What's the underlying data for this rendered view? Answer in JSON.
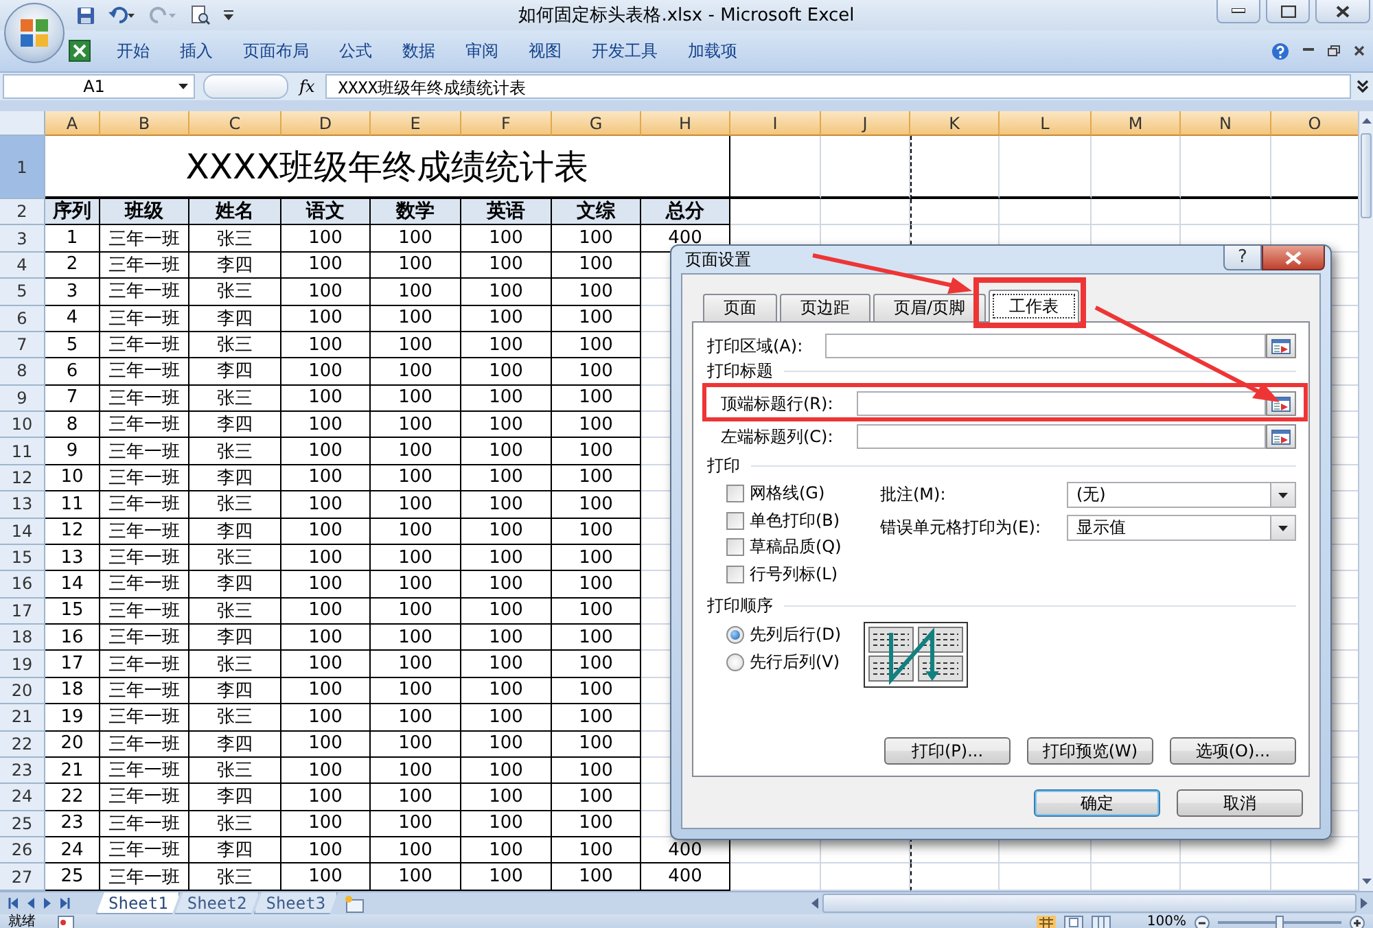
{
  "window": {
    "title": "如何固定标头表格.xlsx - Microsoft Excel"
  },
  "ribbon_tabs": [
    "开始",
    "插入",
    "页面布局",
    "公式",
    "数据",
    "审阅",
    "视图",
    "开发工具",
    "加载项"
  ],
  "formula_bar": {
    "name_box": "A1",
    "function_symbol": "fx",
    "formula": "XXXX班级年终成绩统计表"
  },
  "sheet": {
    "columns": [
      "A",
      "B",
      "C",
      "D",
      "E",
      "F",
      "G",
      "H",
      "I",
      "J",
      "K",
      "L",
      "M",
      "N",
      "O"
    ],
    "title_row": {
      "number": "1",
      "text": "XXXX班级年终成绩统计表"
    },
    "header_row": {
      "number": "2",
      "cells": [
        "序列",
        "班级",
        "姓名",
        "语文",
        "数学",
        "英语",
        "文综",
        "总分"
      ]
    },
    "rows": [
      {
        "number": "3",
        "cells": [
          "1",
          "三年一班",
          "张三",
          "100",
          "100",
          "100",
          "100",
          "400"
        ]
      },
      {
        "number": "4",
        "cells": [
          "2",
          "三年一班",
          "李四",
          "100",
          "100",
          "100",
          "100"
        ]
      },
      {
        "number": "5",
        "cells": [
          "3",
          "三年一班",
          "张三",
          "100",
          "100",
          "100",
          "100"
        ]
      },
      {
        "number": "6",
        "cells": [
          "4",
          "三年一班",
          "李四",
          "100",
          "100",
          "100",
          "100"
        ]
      },
      {
        "number": "7",
        "cells": [
          "5",
          "三年一班",
          "张三",
          "100",
          "100",
          "100",
          "100"
        ]
      },
      {
        "number": "8",
        "cells": [
          "6",
          "三年一班",
          "李四",
          "100",
          "100",
          "100",
          "100"
        ]
      },
      {
        "number": "9",
        "cells": [
          "7",
          "三年一班",
          "张三",
          "100",
          "100",
          "100",
          "100"
        ]
      },
      {
        "number": "10",
        "cells": [
          "8",
          "三年一班",
          "李四",
          "100",
          "100",
          "100",
          "100"
        ]
      },
      {
        "number": "11",
        "cells": [
          "9",
          "三年一班",
          "张三",
          "100",
          "100",
          "100",
          "100"
        ]
      },
      {
        "number": "12",
        "cells": [
          "10",
          "三年一班",
          "李四",
          "100",
          "100",
          "100",
          "100"
        ]
      },
      {
        "number": "13",
        "cells": [
          "11",
          "三年一班",
          "张三",
          "100",
          "100",
          "100",
          "100"
        ]
      },
      {
        "number": "14",
        "cells": [
          "12",
          "三年一班",
          "李四",
          "100",
          "100",
          "100",
          "100"
        ]
      },
      {
        "number": "15",
        "cells": [
          "13",
          "三年一班",
          "张三",
          "100",
          "100",
          "100",
          "100"
        ]
      },
      {
        "number": "16",
        "cells": [
          "14",
          "三年一班",
          "李四",
          "100",
          "100",
          "100",
          "100"
        ]
      },
      {
        "number": "17",
        "cells": [
          "15",
          "三年一班",
          "张三",
          "100",
          "100",
          "100",
          "100"
        ]
      },
      {
        "number": "18",
        "cells": [
          "16",
          "三年一班",
          "李四",
          "100",
          "100",
          "100",
          "100"
        ]
      },
      {
        "number": "19",
        "cells": [
          "17",
          "三年一班",
          "张三",
          "100",
          "100",
          "100",
          "100"
        ]
      },
      {
        "number": "20",
        "cells": [
          "18",
          "三年一班",
          "李四",
          "100",
          "100",
          "100",
          "100"
        ]
      },
      {
        "number": "21",
        "cells": [
          "19",
          "三年一班",
          "张三",
          "100",
          "100",
          "100",
          "100"
        ]
      },
      {
        "number": "22",
        "cells": [
          "20",
          "三年一班",
          "李四",
          "100",
          "100",
          "100",
          "100"
        ]
      },
      {
        "number": "23",
        "cells": [
          "21",
          "三年一班",
          "张三",
          "100",
          "100",
          "100",
          "100"
        ]
      },
      {
        "number": "24",
        "cells": [
          "22",
          "三年一班",
          "李四",
          "100",
          "100",
          "100",
          "100"
        ]
      },
      {
        "number": "25",
        "cells": [
          "23",
          "三年一班",
          "张三",
          "100",
          "100",
          "100",
          "100"
        ]
      },
      {
        "number": "26",
        "cells": [
          "24",
          "三年一班",
          "李四",
          "100",
          "100",
          "100",
          "100",
          "400"
        ]
      },
      {
        "number": "27",
        "cells": [
          "25",
          "三年一班",
          "张三",
          "100",
          "100",
          "100",
          "100",
          "400"
        ]
      }
    ]
  },
  "sheet_tabs": [
    {
      "label": "Sheet1",
      "selected": true
    },
    {
      "label": "Sheet2",
      "selected": false
    },
    {
      "label": "Sheet3",
      "selected": false
    }
  ],
  "status_bar": {
    "status": "就绪",
    "zoom": "100%",
    "zoom_slider": {
      "level": 0.5
    }
  },
  "dialog": {
    "title": "页面设置",
    "help_button": "?",
    "tabs": [
      {
        "label": "页面",
        "selected": false
      },
      {
        "label": "页边距",
        "selected": false
      },
      {
        "label": "页眉/页脚",
        "selected": false
      },
      {
        "label": "工作表",
        "selected": true
      }
    ],
    "print_area": {
      "label": "打印区域(A):"
    },
    "print_titles": {
      "heading": "打印标题",
      "fields": [
        {
          "label": "顶端标题行(R):"
        },
        {
          "label": "左端标题列(C):"
        }
      ]
    },
    "print": {
      "heading": "打印",
      "checkboxes": [
        {
          "label": "网格线(G)",
          "checked": false
        },
        {
          "label": "单色打印(B)",
          "checked": false
        },
        {
          "label": "草稿品质(Q)",
          "checked": false
        },
        {
          "label": "行号列标(L)",
          "checked": false
        }
      ],
      "selects": [
        {
          "label": "批注(M):",
          "value": "(无)"
        },
        {
          "label": "错误单元格打印为(E):",
          "value": "显示值"
        }
      ]
    },
    "print_order": {
      "heading": "打印顺序",
      "options": [
        {
          "label": "先列后行(D)",
          "selected": true
        },
        {
          "label": "先行后列(V)",
          "selected": false
        }
      ]
    },
    "buttons": [
      "打印(P)...",
      "打印预览(W)",
      "选项(O)..."
    ],
    "footer_buttons": [
      "确定",
      "取消"
    ]
  }
}
